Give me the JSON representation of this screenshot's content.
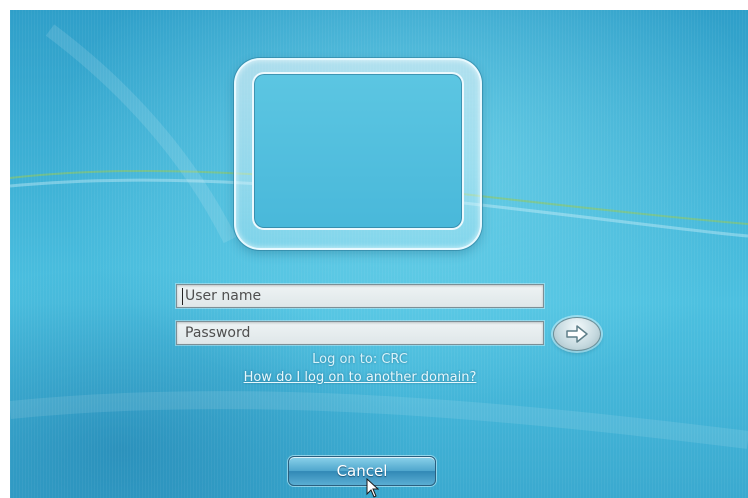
{
  "login": {
    "username": {
      "value": "",
      "placeholder": "User name"
    },
    "password": {
      "value": "",
      "placeholder": "Password"
    },
    "logon_to": "Log on to: CRC",
    "other_domain_link": "How do I log on to another domain?",
    "go_icon": "arrow-right-icon"
  },
  "actions": {
    "cancel_label": "Cancel"
  },
  "colors": {
    "background": "#3fb2d6",
    "button": "#4fa6cd"
  }
}
